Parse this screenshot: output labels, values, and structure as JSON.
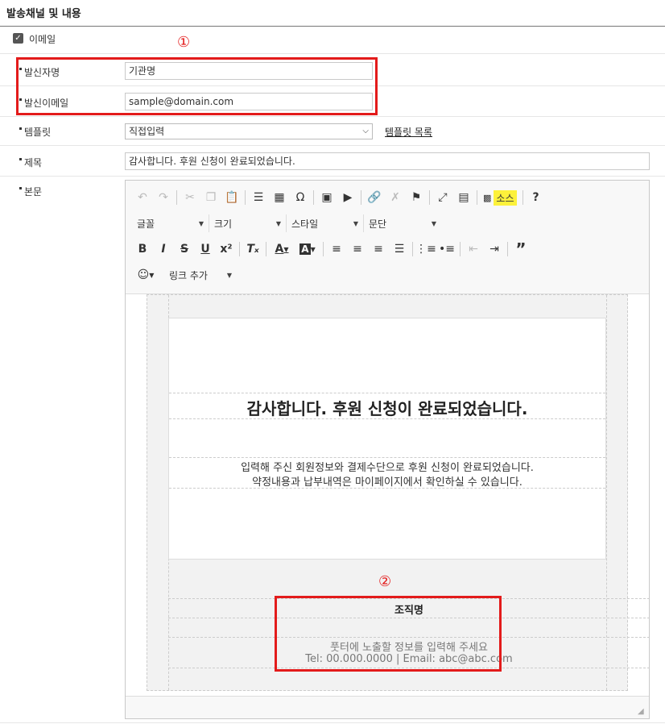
{
  "section_title": "발송채널 및 내용",
  "email_option": {
    "checked": true,
    "label": "이메일"
  },
  "fields": {
    "sender_name": {
      "label": "발신자명",
      "value": "기관명"
    },
    "sender_email": {
      "label": "발신이메일",
      "value": "sample@domain.com"
    },
    "template": {
      "label": "템플릿",
      "selected": "직접입력",
      "list_link": "템플릿 목록"
    },
    "subject": {
      "label": "제목",
      "value": "감사합니다. 후원 신청이 완료되었습니다."
    },
    "body": {
      "label": "본문"
    }
  },
  "annotations": {
    "marker1": "①",
    "marker2": "②",
    "highlight_color": "#e31b1b"
  },
  "editor": {
    "combos": {
      "font": "글꼴",
      "size": "크기",
      "style": "스타일",
      "paragraph": "문단",
      "link_add": "링크 추가"
    },
    "source_button": "소스",
    "content": {
      "title": "감사합니다. 후원 신청이 완료되었습니다.",
      "line1": "입력해 주신 회원정보와 결제수단으로 후원 신청이 완료되었습니다.",
      "line2": "약정내용과 납부내역은 마이페이지에서 확인하실 수 있습니다.",
      "org_name": "조직명",
      "footer_placeholder": "풋터에 노출할 정보를 입력해 주세요",
      "footer_contact": "Tel: 00.000.0000 | Email: abc@abc.com"
    }
  }
}
